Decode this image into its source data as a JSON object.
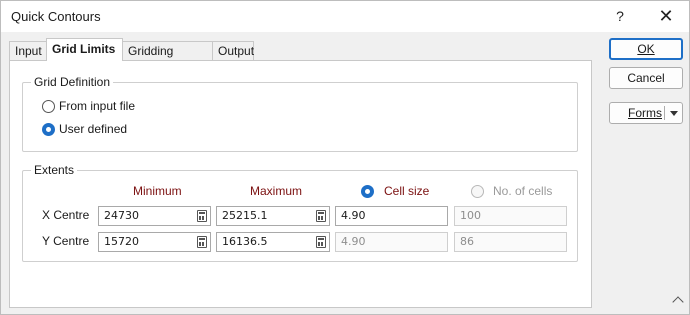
{
  "window": {
    "title": "Quick Contours",
    "help": "?",
    "close": "✕"
  },
  "tabs": [
    {
      "label": "Input",
      "active": false
    },
    {
      "label": "Grid Limits",
      "active": true
    },
    {
      "label": "Gridding Method",
      "active": false
    },
    {
      "label": "Output",
      "active": false
    }
  ],
  "grid_definition": {
    "title": "Grid Definition",
    "options": [
      {
        "label": "From input file",
        "selected": false
      },
      {
        "label": "User defined",
        "selected": true
      }
    ]
  },
  "extents": {
    "title": "Extents",
    "columns": {
      "minimum": "Minimum",
      "maximum": "Maximum",
      "cell_size": "Cell size",
      "num_cells": "No. of cells"
    },
    "cell_mode": "Cell size",
    "rows": [
      {
        "label": "X Centre",
        "minimum": "24730",
        "maximum": "25215.1",
        "cell_size": "4.90",
        "num_cells": "100"
      },
      {
        "label": "Y Centre",
        "minimum": "15720",
        "maximum": "16136.5",
        "cell_size": "4.90",
        "num_cells": "86"
      }
    ]
  },
  "buttons": {
    "ok": "OK",
    "cancel": "Cancel",
    "forms": "Forms"
  },
  "colors": {
    "accent": "#1e6fc7",
    "header_text": "#7b1010"
  }
}
